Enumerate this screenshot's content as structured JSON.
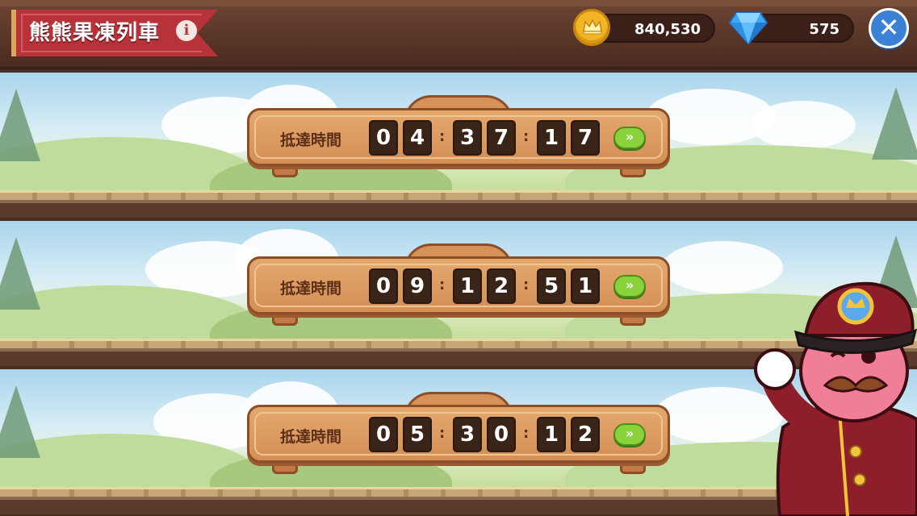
{
  "header": {
    "title": "熊熊果凍列車",
    "gold_amount": "840,530",
    "gem_amount": "575"
  },
  "trains": [
    {
      "arrive_label": "抵達時間",
      "digits": [
        "0",
        "4",
        "3",
        "7",
        "1",
        "7"
      ]
    },
    {
      "arrive_label": "抵達時間",
      "digits": [
        "0",
        "9",
        "1",
        "2",
        "5",
        "1"
      ]
    },
    {
      "arrive_label": "抵達時間",
      "digits": [
        "0",
        "5",
        "3",
        "0",
        "1",
        "2"
      ]
    }
  ],
  "colors": {
    "banner": "#b8323a",
    "skip_button": "#8ad23c",
    "close_button": "#3b82d6",
    "coin": "#f2b526"
  },
  "icons": {
    "info": "info-icon",
    "coin": "crown-coin-icon",
    "gem": "diamond-icon",
    "close": "close-icon",
    "skip": "fast-forward-icon"
  }
}
